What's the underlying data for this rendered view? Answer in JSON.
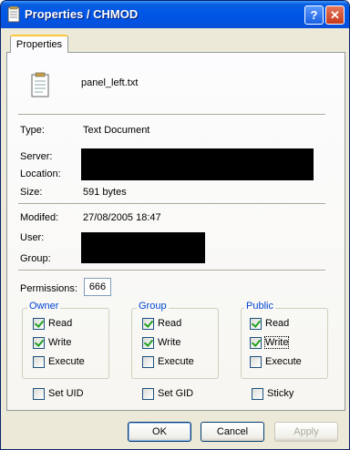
{
  "window": {
    "title": "Properties / CHMOD"
  },
  "tabs": [
    {
      "label": "Properties"
    }
  ],
  "file": {
    "name": "panel_left.txt"
  },
  "info": {
    "type_label": "Type:",
    "type_value": "Text Document",
    "server_label": "Server:",
    "location_label": "Location:",
    "size_label": "Size:",
    "size_value": "591 bytes",
    "modified_label": "Modifed:",
    "modified_value": "27/08/2005 18:47",
    "user_label": "User:",
    "group_label": "Group:"
  },
  "permissions": {
    "label": "Permissions:",
    "value": "666",
    "groups": [
      {
        "title": "Owner",
        "read": "Read",
        "write": "Write",
        "execute": "Execute",
        "read_checked": true,
        "write_checked": true,
        "execute_checked": false
      },
      {
        "title": "Group",
        "read": "Read",
        "write": "Write",
        "execute": "Execute",
        "read_checked": true,
        "write_checked": true,
        "execute_checked": false
      },
      {
        "title": "Public",
        "read": "Read",
        "write": "Write",
        "execute": "Execute",
        "read_checked": true,
        "write_checked": true,
        "execute_checked": false
      }
    ],
    "set_uid": "Set UID",
    "set_gid": "Set GID",
    "sticky": "Sticky"
  },
  "buttons": {
    "ok": "OK",
    "cancel": "Cancel",
    "apply": "Apply"
  },
  "colors": {
    "title_bar": "#0054e3",
    "group_title": "#0046d5",
    "dialog_bg": "#ece9d8"
  }
}
